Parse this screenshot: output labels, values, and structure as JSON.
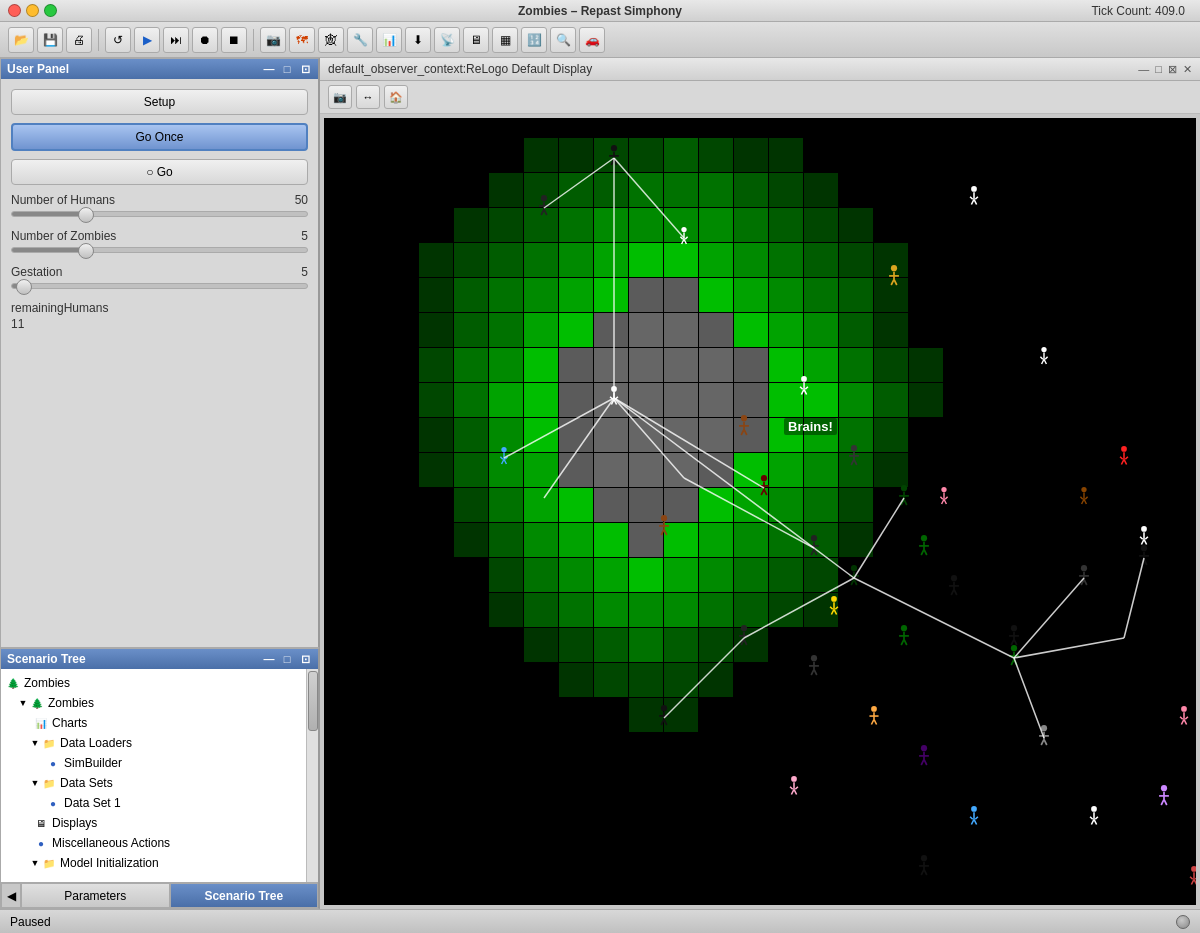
{
  "window": {
    "title": "Zombies – Repast Simphony",
    "tick_count_label": "Tick Count: 409.0"
  },
  "title_bar_buttons": {
    "close": "●",
    "minimize": "●",
    "maximize": "●"
  },
  "toolbar": {
    "buttons": [
      {
        "icon": "📁",
        "name": "open-icon"
      },
      {
        "icon": "💾",
        "name": "save-icon"
      },
      {
        "icon": "🖨",
        "name": "print-icon"
      },
      {
        "icon": "↩",
        "name": "undo-icon"
      },
      {
        "icon": "▶",
        "name": "play-icon"
      },
      {
        "icon": "⏭",
        "name": "fast-forward-icon"
      },
      {
        "icon": "⏺",
        "name": "record-icon"
      },
      {
        "icon": "⏹",
        "name": "stop-icon"
      },
      {
        "icon": "📷",
        "name": "screenshot-icon"
      },
      {
        "icon": "🗺",
        "name": "map-icon"
      },
      {
        "icon": "🔧",
        "name": "settings-icon"
      },
      {
        "icon": "📊",
        "name": "chart-icon"
      },
      {
        "icon": "⬇",
        "name": "download-icon"
      },
      {
        "icon": "📡",
        "name": "network-icon"
      },
      {
        "icon": "🖥",
        "name": "display-icon"
      },
      {
        "icon": "📋",
        "name": "clipboard-icon"
      },
      {
        "icon": "🔢",
        "name": "grid-icon"
      },
      {
        "icon": "🔍",
        "name": "search-icon"
      },
      {
        "icon": "🚗",
        "name": "run-icon"
      }
    ]
  },
  "user_panel": {
    "title": "User Panel",
    "buttons": {
      "setup": "Setup",
      "go_once": "Go Once",
      "go": "○ Go"
    },
    "sliders": {
      "humans": {
        "label": "Number of Humans",
        "value": 50,
        "min": 0,
        "max": 200,
        "percent": 25
      },
      "zombies": {
        "label": "Number of Zombies",
        "value": 5,
        "min": 0,
        "max": 20,
        "percent": 25
      },
      "gestation": {
        "label": "Gestation",
        "value": 5,
        "min": 0,
        "max": 20,
        "percent": 4
      }
    },
    "stats": {
      "remaining_humans_label": "remainingHumans",
      "remaining_humans_value": "11"
    }
  },
  "scenario_tree": {
    "title": "Scenario Tree",
    "items": [
      {
        "id": "zombies-root",
        "label": "Zombies",
        "level": 0,
        "icon": "tree",
        "toggle": null
      },
      {
        "id": "zombies-child",
        "label": "Zombies",
        "level": 1,
        "icon": "tree",
        "toggle": "▼"
      },
      {
        "id": "charts",
        "label": "Charts",
        "level": 2,
        "icon": "chart",
        "toggle": null
      },
      {
        "id": "data-loaders",
        "label": "Data Loaders",
        "level": 2,
        "icon": "folder",
        "toggle": "▼"
      },
      {
        "id": "simbuilder",
        "label": "SimBuilder",
        "level": 3,
        "icon": "dot",
        "toggle": null
      },
      {
        "id": "data-sets",
        "label": "Data Sets",
        "level": 2,
        "icon": "folder",
        "toggle": "▼"
      },
      {
        "id": "data-set-1",
        "label": "Data Set 1",
        "level": 3,
        "icon": "dot",
        "toggle": null
      },
      {
        "id": "displays",
        "label": "Displays",
        "level": 2,
        "icon": "display",
        "toggle": null
      },
      {
        "id": "misc-actions",
        "label": "Miscellaneous Actions",
        "level": 2,
        "icon": "dot",
        "toggle": null
      },
      {
        "id": "model-init",
        "label": "Model Initialization",
        "level": 2,
        "icon": "folder",
        "toggle": "▼"
      }
    ]
  },
  "tabs": {
    "parameters": "Parameters",
    "scenario_tree": "Scenario Tree",
    "active": "scenario_tree"
  },
  "display": {
    "title": "default_observer_context:ReLogo Default Display",
    "brains_label": "Brains!"
  },
  "status_bar": {
    "text": "Paused"
  }
}
